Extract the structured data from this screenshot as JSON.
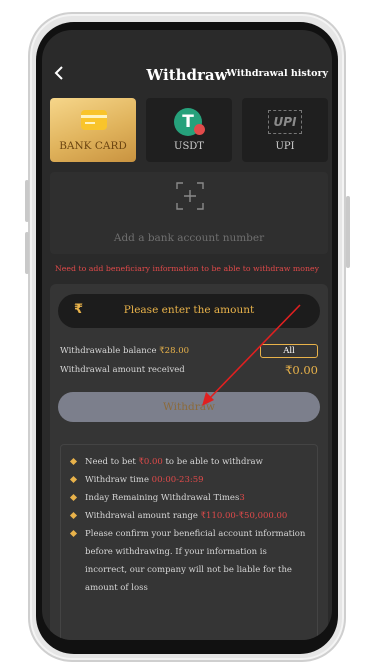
{
  "header": {
    "title": "Withdraw",
    "history_label": "Withdrawal history"
  },
  "tabs": [
    {
      "label": "BANK CARD",
      "icon": "bank-card-icon",
      "active": true
    },
    {
      "label": "USDT",
      "icon": "usdt-icon",
      "active": false
    },
    {
      "label": "UPI",
      "icon": "upi-icon",
      "active": false
    }
  ],
  "upi_logo": "UPI",
  "usdt_logo": "T",
  "add_bank": {
    "text": "Add a bank account number"
  },
  "warning": "Need to add beneficiary information to be able to withdraw money",
  "amount": {
    "currency_symbol": "₹",
    "placeholder": "Please enter the amount"
  },
  "balance": {
    "label": "Withdrawable balance ",
    "value": "₹28.00",
    "all_button": "All"
  },
  "received": {
    "label": "Withdrawal amount received",
    "value": "₹0.00"
  },
  "withdraw_button": "Withdraw",
  "rules": [
    {
      "pre": "Need to bet ",
      "hl": "₹0.00",
      "post": " to be able to withdraw"
    },
    {
      "pre": "Withdraw time ",
      "hl": "00:00-23:59",
      "post": ""
    },
    {
      "pre": "Inday Remaining Withdrawal Times",
      "hl": "3",
      "post": ""
    },
    {
      "pre": "Withdrawal amount range ",
      "hl": "₹110.00-₹50,000.00",
      "post": ""
    },
    {
      "pre": "Please confirm your beneficial account information before withdrawing. If your information is incorrect, our company will not be liable for the amount of loss",
      "hl": "",
      "post": ""
    }
  ],
  "colors": {
    "accent": "#e8b24a",
    "warning": "#e04a4a",
    "screen_bg": "#2a2a2a",
    "button_bg": "#7c7f8c",
    "arrow": "#e02020"
  }
}
